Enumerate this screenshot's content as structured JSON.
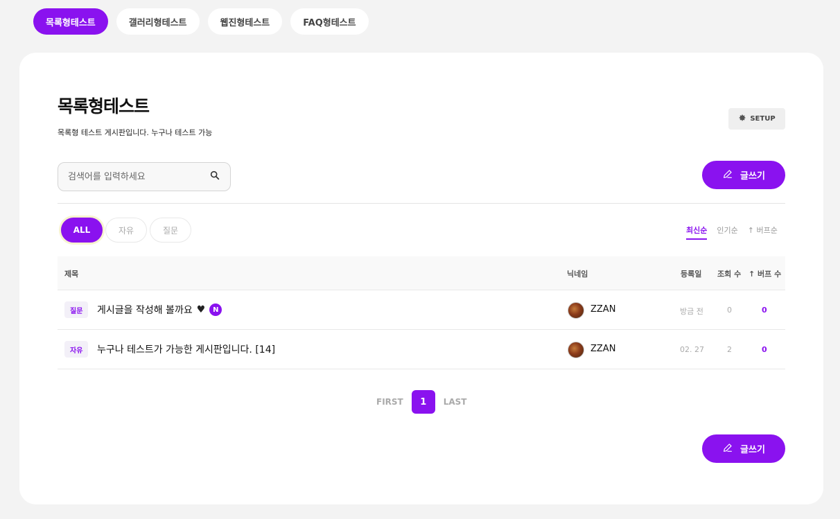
{
  "top_tabs": [
    {
      "label": "목록형테스트",
      "active": true
    },
    {
      "label": "갤러리형테스트",
      "active": false
    },
    {
      "label": "웹진형테스트",
      "active": false
    },
    {
      "label": "FAQ형테스트",
      "active": false
    }
  ],
  "board": {
    "title": "목록형테스트",
    "description": "목록형 테스트 게시판입니다. 누구나 테스트 가능",
    "setup_label": "SETUP"
  },
  "search": {
    "placeholder": "검색어를 입력하세요"
  },
  "write_label": "글쓰기",
  "categories": [
    {
      "label": "ALL",
      "active": true
    },
    {
      "label": "자유",
      "active": false
    },
    {
      "label": "질문",
      "active": false
    }
  ],
  "sorts": [
    {
      "label": "최신순",
      "active": true
    },
    {
      "label": "인기순",
      "active": false
    },
    {
      "label": "↑ 버프순",
      "active": false
    }
  ],
  "table": {
    "headers": {
      "subject": "제목",
      "nickname": "닉네임",
      "date": "등록일",
      "views": "조회 수",
      "buffs": "↑ 버프 수"
    },
    "rows": [
      {
        "category": "질문",
        "subject": "게시글을 작성해 볼까요",
        "heart": "♥",
        "new_badge": "N",
        "nickname": "ZZAN",
        "date": "방금 전",
        "views": "0",
        "buffs": "0"
      },
      {
        "category": "자유",
        "subject": "누구나 테스트가 가능한 게시판입니다.  [14]",
        "nickname": "ZZAN",
        "date": "02. 27",
        "views": "2",
        "buffs": "0"
      }
    ]
  },
  "pagination": {
    "first": "FIRST",
    "current": "1",
    "last": "LAST"
  },
  "colors": {
    "accent": "#8a12ef",
    "background": "#f3f3f3"
  }
}
